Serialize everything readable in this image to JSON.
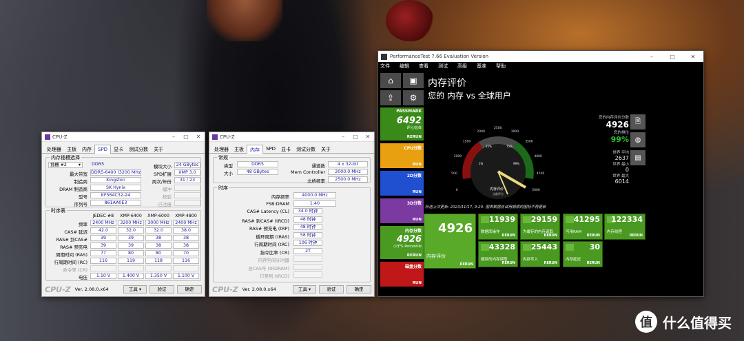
{
  "cpuz1": {
    "title": "CPU-Z",
    "tabs": [
      "处理器",
      "主板",
      "内存",
      "SPD",
      "显卡",
      "测试分数",
      "关于"
    ],
    "group_slot": "内存插槽选择",
    "slot_value": "插槽 #2",
    "ddr": "DDR5",
    "module_size_label": "模块大小",
    "module_size": "24 GBytes",
    "max_bw_label": "最大带宽",
    "max_bw": "DDR5-6400 (3200 MHz)",
    "spd_ext_label": "SPD扩展",
    "spd_ext": "XMP 3.0",
    "mfr_label": "制造商",
    "mfr": "Kingston",
    "week_label": "周次/年份",
    "week": "31 / 23",
    "dram_mfr_label": "DRAM 制造商",
    "dram_mfr": "SK Hynix",
    "buffer_label": "缓冲",
    "model_label": "型号",
    "model": "KF564C32-24",
    "check_label": "校验",
    "serial_label": "序列号",
    "serial": "861AA0E3",
    "reg_label": "已注册",
    "group_timing": "时序表",
    "cols": [
      "JEDEC #8",
      "XMP-6400",
      "XMP-6000",
      "XMP-4800"
    ],
    "rows": [
      {
        "label": "频率",
        "vals": [
          "2400 MHz",
          "3200 MHz",
          "3000 MHz",
          "2400 MHz"
        ]
      },
      {
        "label": "CAS# 延迟",
        "vals": [
          "42.0",
          "32.0",
          "32.0",
          "38.0"
        ]
      },
      {
        "label": "RAS# 到CAS# ",
        "vals": [
          "39",
          "39",
          "38",
          "38"
        ]
      },
      {
        "label": "RAS# 预充电",
        "vals": [
          "39",
          "39",
          "38",
          "38"
        ]
      },
      {
        "label": "周期时间 (RAS)",
        "vals": [
          "77",
          "80",
          "80",
          "70"
        ]
      },
      {
        "label": "行周期时间 (RC)",
        "vals": [
          "116",
          "119",
          "118",
          "116"
        ]
      },
      {
        "label": "命令率 (CR)",
        "vals": [
          "",
          "",
          "",
          ""
        ]
      },
      {
        "label": "电压",
        "vals": [
          "1.10 V",
          "1.400 V",
          "1.350 V",
          "1.100 V"
        ]
      }
    ],
    "brand": "CPU-Z",
    "ver": "Ver. 2.08.0.x64",
    "tools": "工具",
    "validate": "验证",
    "ok": "确定"
  },
  "cpuz2": {
    "title": "CPU-Z",
    "tabs": [
      "处理器",
      "主板",
      "内存",
      "SPD",
      "显卡",
      "测试分数",
      "关于"
    ],
    "group_general": "常规",
    "type_label": "类型",
    "type": "DDR5",
    "size_label": "大小",
    "size": "48 GBytes",
    "channels_label": "通道数",
    "channels": "4 x 32-bit",
    "mc_label": "Mem Controller",
    "mc": "2000.0 MHz",
    "nb_label": "北桥频率",
    "nb": "2500.0 MHz",
    "group_timing": "时序",
    "rows": [
      {
        "label": "内存频率",
        "val": "4000.0 MHz",
        "dim": false
      },
      {
        "label": "FSB:DRAM",
        "val": "1:40",
        "dim": false
      },
      {
        "label": "CAS# Latency (CL)",
        "val": "34.0 时钟",
        "dim": false
      },
      {
        "label": "RAS# 到CAS# (tRCD)",
        "val": "48 时钟",
        "dim": false
      },
      {
        "label": "RAS# 预充电 (tRP)",
        "val": "48 时钟",
        "dim": false
      },
      {
        "label": "循环周期 (tRAS)",
        "val": "58 时钟",
        "dim": false
      },
      {
        "label": "行周期时间 (tRC)",
        "val": "106 时钟",
        "dim": false
      },
      {
        "label": "指令比率 (CR)",
        "val": "2T",
        "dim": false
      },
      {
        "label": "内存空闲计时器",
        "val": "",
        "dim": true
      },
      {
        "label": "总CAS号 (tRDRAM)",
        "val": "",
        "dim": true
      },
      {
        "label": "行至列 (tRCD)",
        "val": "",
        "dim": true
      }
    ],
    "brand": "CPU-Z",
    "ver": "Ver. 2.08.0.x64",
    "tools": "工具",
    "validate": "验证",
    "ok": "确定"
  },
  "pt": {
    "title": "PerformanceTest 7.66 Evaluation Version",
    "menu": [
      "文件",
      "编辑",
      "查看",
      "测试",
      "高级",
      "基准",
      "帮助"
    ],
    "heading": "内存评价",
    "subheading": "您的 内存 vs 全球用户",
    "passmark": {
      "name": "PASSMARK",
      "value": "6492",
      "sub": "评分/总体",
      "run": "RERUN"
    },
    "cats": [
      {
        "name": "CPU分数",
        "run": "RUN",
        "color": "#e8a010"
      },
      {
        "name": "2D分数",
        "run": "RUN",
        "color": "#2050d0"
      },
      {
        "name": "3D分数",
        "run": "RUN",
        "color": "#7a3aa0"
      },
      {
        "name": "内存分数",
        "run": "RERUN",
        "color": "#4a9a22",
        "value": "4926",
        "sub": "小于% Percentile"
      },
      {
        "name": "磁盘分数",
        "run": "RUN",
        "color": "#c01818"
      }
    ],
    "gauge_ticks": [
      "0",
      "500",
      "1000",
      "1500",
      "2000",
      "2500",
      "3000",
      "3500",
      "4000",
      "4500",
      "5000"
    ],
    "gauge_pcts": [
      "1%",
      "25%",
      "75%",
      "99%"
    ],
    "gauge_label": "内存评价",
    "gauge_sublabel": "当前评分",
    "your_score_label": "您的内存评价分数",
    "your_score": "4926",
    "rank_label": "您的排位",
    "rank": "99%",
    "world_avg_label": "世界 平均",
    "world_avg": "2637",
    "world_min_label": "世界 最小",
    "world_min": "0",
    "world_max_label": "世界 最大",
    "world_max": "6014",
    "note": "所选上次更新: 2023/11/17, 9:20. 图表数据自试用期限的图标不再更新",
    "main_tile": {
      "value": "4926",
      "label": "内存评价",
      "run": "RERUN"
    },
    "tiles": [
      {
        "value": "11939",
        "label": "数据库操作",
        "run": "RERUN"
      },
      {
        "value": "29159",
        "label": "为缓存的内存读取",
        "run": "RERUN"
      },
      {
        "value": "41295",
        "label": "可用RAM",
        "run": "RERUN"
      },
      {
        "value": "122334",
        "label": "内存线程",
        "run": "RERUN"
      },
      {
        "value": "43328",
        "label": "缓存的内存读取",
        "run": "RERUN"
      },
      {
        "value": "25443",
        "label": "内存写入",
        "run": "RERUN"
      },
      {
        "value": "30",
        "label": "内存延迟",
        "run": "RERUN"
      }
    ]
  },
  "watermark": {
    "text": "什么值得买",
    "logo": "值"
  }
}
